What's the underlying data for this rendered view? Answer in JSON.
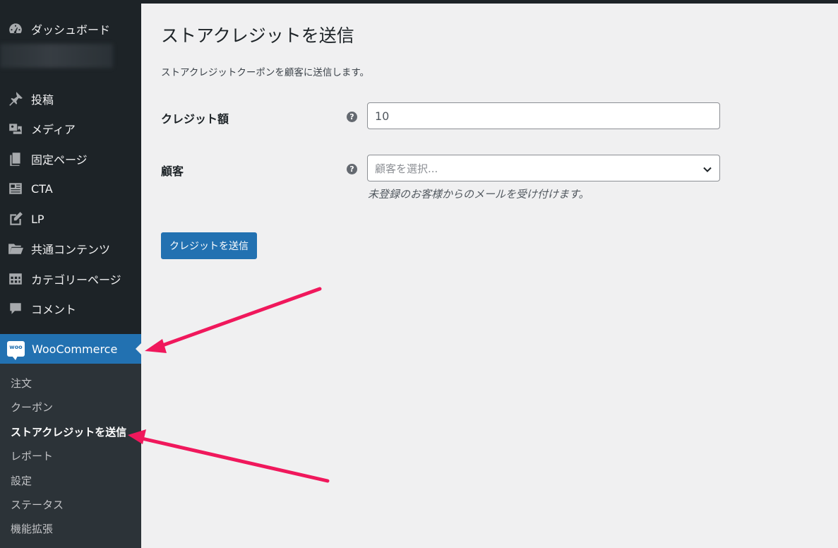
{
  "sidebar": {
    "items": [
      {
        "label": "ダッシュボード",
        "icon": "dashboard-icon"
      },
      {
        "label": "投稿",
        "icon": "pin-icon"
      },
      {
        "label": "メディア",
        "icon": "media-icon"
      },
      {
        "label": "固定ページ",
        "icon": "pages-icon"
      },
      {
        "label": "CTA",
        "icon": "cta-icon"
      },
      {
        "label": "LP",
        "icon": "edit-icon"
      },
      {
        "label": "共通コンテンツ",
        "icon": "folder-icon"
      },
      {
        "label": "カテゴリーページ",
        "icon": "table-icon"
      },
      {
        "label": "コメント",
        "icon": "comment-icon"
      }
    ],
    "woocommerce": {
      "label": "WooCommerce",
      "logo_text": "woo"
    },
    "submenu": [
      {
        "label": "注文"
      },
      {
        "label": "クーポン"
      },
      {
        "label": "ストアクレジットを送信"
      },
      {
        "label": "レポート"
      },
      {
        "label": "設定"
      },
      {
        "label": "ステータス"
      },
      {
        "label": "機能拡張"
      }
    ]
  },
  "main": {
    "title": "ストアクレジットを送信",
    "description": "ストアクレジットクーポンを顧客に送信します。",
    "credit_amount": {
      "label": "クレジット額",
      "value": "10",
      "help": "?"
    },
    "customer": {
      "label": "顧客",
      "placeholder": "顧客を選択...",
      "help": "?",
      "hint": "未登録のお客様からのメールを受け付けます。"
    },
    "submit_label": "クレジットを送信"
  },
  "colors": {
    "accent": "#2271b1",
    "sidebar": "#1d2327",
    "annotation_arrow": "#f0185c"
  }
}
